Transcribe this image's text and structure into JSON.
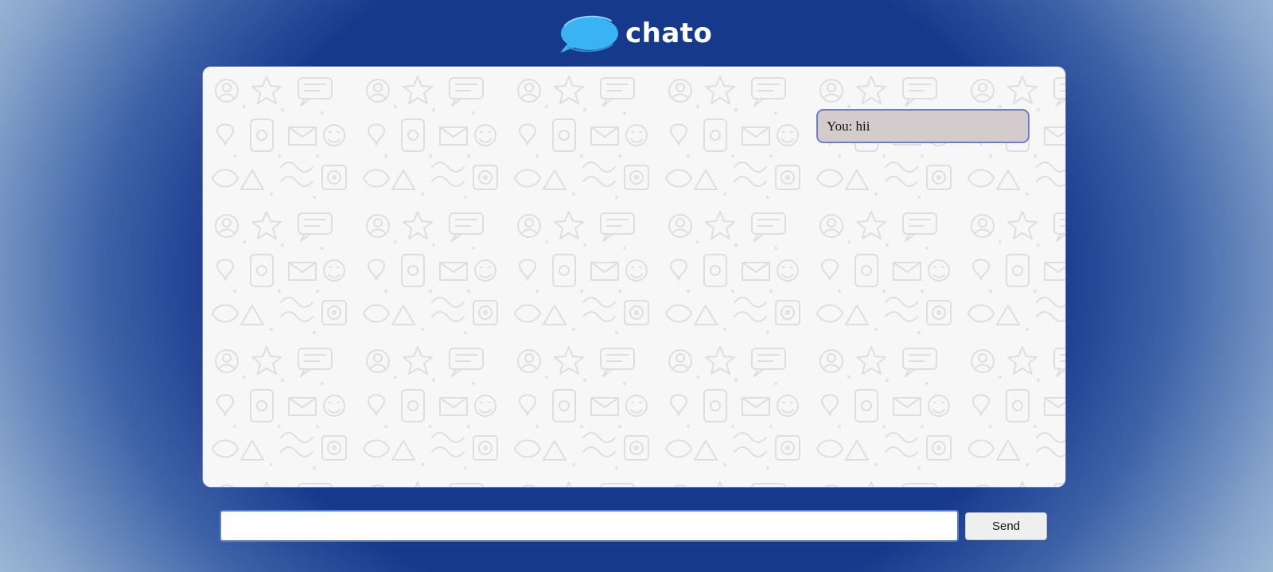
{
  "app": {
    "brand_name": "chato",
    "brand_color": "#3ab3f5",
    "logo_icon": "speech-bubble-icon"
  },
  "colors": {
    "background_center": "#143a8d",
    "background_edge": "#b0cade",
    "panel_border": "#6a7fc6",
    "bubble_fill": "#d4cccc",
    "bubble_border": "#6b7fd0",
    "input_border": "#5e7dd4"
  },
  "chat": {
    "messages": [
      {
        "text": "You: hii"
      }
    ]
  },
  "composer": {
    "input_value": "",
    "input_placeholder": "",
    "send_label": "Send"
  }
}
